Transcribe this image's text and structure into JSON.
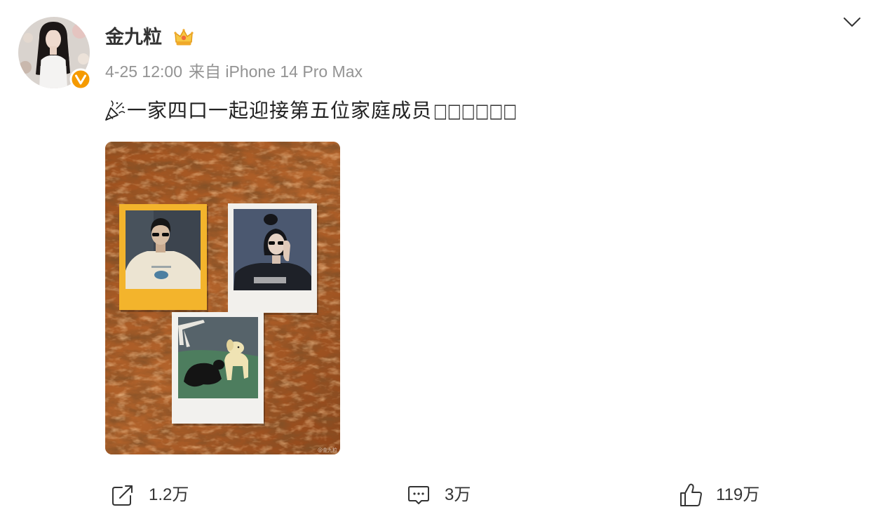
{
  "post": {
    "author": {
      "name": "金九粒",
      "verified": true
    },
    "meta": {
      "time": "4-25 12:00",
      "source": "来自 iPhone 14 Pro Max"
    },
    "content": {
      "text": "一家四口一起迎接第五位家庭成员",
      "trailing_glyphs": "□□□□□□"
    },
    "image": {
      "watermark": "@金九粒"
    },
    "actions": {
      "share_count": "1.2万",
      "comment_count": "3万",
      "like_count": "119万"
    }
  },
  "icons": {
    "avatar": "avatar",
    "verified": "verified-v-icon",
    "member_badge": "crown-badge-icon",
    "menu": "chevron-down-icon",
    "emoji": "party-popper-icon",
    "share": "share-icon",
    "comment": "comment-icon",
    "like": "thumbs-up-icon"
  },
  "colors": {
    "background": "#ffffff",
    "text_primary": "#333333",
    "text_secondary": "#939393",
    "verified_badge": "#f59a00",
    "member_badge": "#f7c843"
  }
}
